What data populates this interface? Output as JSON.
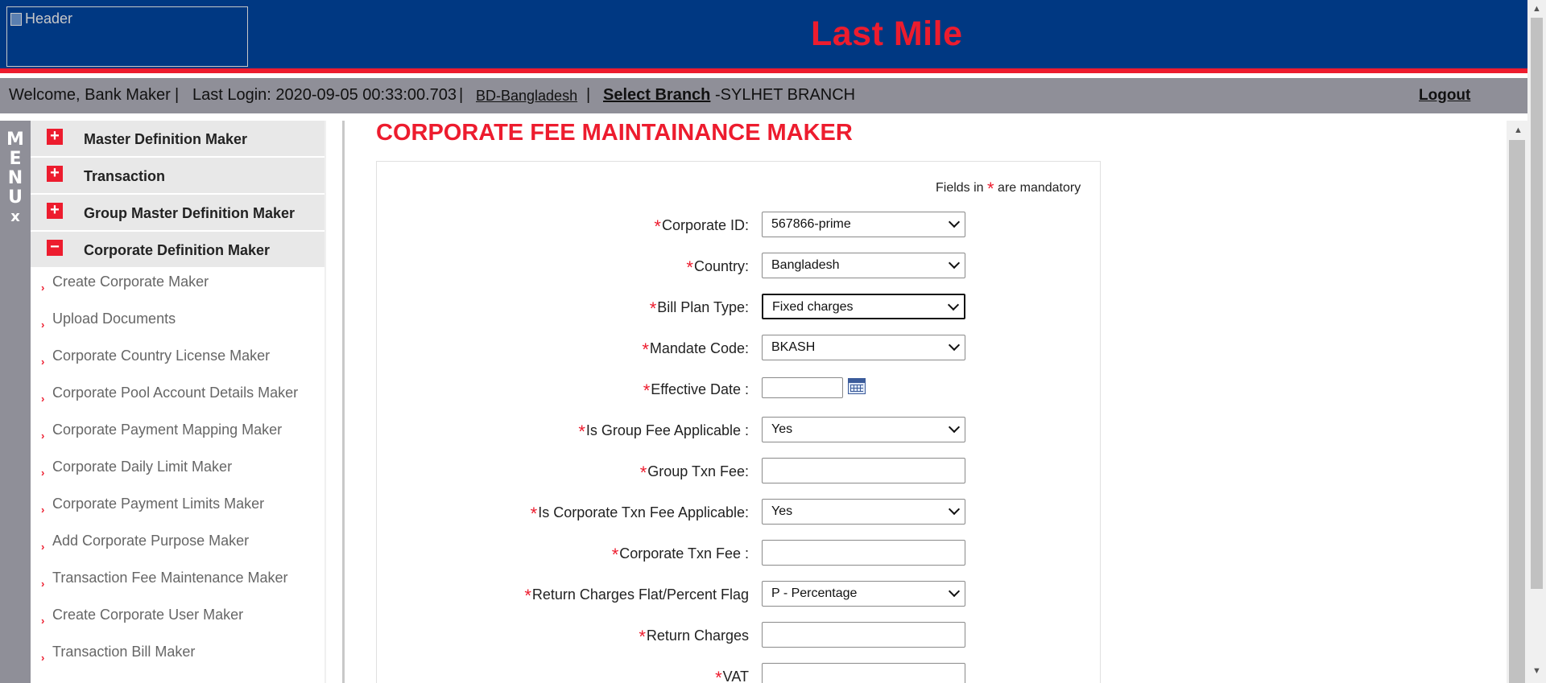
{
  "header": {
    "logo_alt": "Header",
    "title": "Last Mile"
  },
  "infobar": {
    "welcome": "Welcome, Bank Maker",
    "sep": "|",
    "last_login": "Last Login: 2020-09-05 00:33:00.703",
    "country_link": "BD-Bangladesh",
    "select_branch": "Select Branch",
    "branch_name": "-SYLHET BRANCH",
    "logout": "Logout"
  },
  "menu_strip": {
    "letters": [
      "M",
      "E",
      "N",
      "U"
    ],
    "close": "x"
  },
  "sidebar": {
    "groups": [
      {
        "label": "Master Definition Maker",
        "toggle": "+"
      },
      {
        "label": "Transaction",
        "toggle": "+"
      },
      {
        "label": "Group Master Definition Maker",
        "toggle": "+"
      },
      {
        "label": "Corporate Definition Maker",
        "toggle": "−"
      }
    ],
    "items": [
      "Create Corporate Maker",
      "Upload Documents",
      "Corporate Country License Maker",
      "Corporate Pool Account Details Maker",
      "Corporate Payment Mapping Maker",
      "Corporate Daily Limit Maker",
      "Corporate Payment Limits Maker",
      "Add Corporate Purpose Maker",
      "Transaction Fee Maintenance Maker",
      "Create Corporate User Maker",
      "Transaction Bill Maker"
    ]
  },
  "page": {
    "title": "CORPORATE FEE MAINTAINANCE MAKER",
    "mandatory_prefix": "Fields in",
    "mandatory_star": "*",
    "mandatory_suffix": "are mandatory"
  },
  "form": {
    "corporate_id": {
      "label": "Corporate ID:",
      "value": "567866-prime"
    },
    "country": {
      "label": "Country:",
      "value": "Bangladesh"
    },
    "bill_plan_type": {
      "label": "Bill Plan Type:",
      "value": "Fixed charges"
    },
    "mandate_code": {
      "label": "Mandate Code:",
      "value": "BKASH"
    },
    "effective_date": {
      "label": "Effective Date :",
      "value": ""
    },
    "is_group_fee": {
      "label": "Is Group Fee Applicable :",
      "value": "Yes"
    },
    "group_txn_fee": {
      "label": "Group Txn Fee:",
      "value": ""
    },
    "is_corp_txn_fee": {
      "label": "Is Corporate Txn Fee Applicable:",
      "value": "Yes"
    },
    "corp_txn_fee": {
      "label": "Corporate Txn Fee :",
      "value": ""
    },
    "return_flag": {
      "label": "Return Charges Flat/Percent Flag",
      "value": "P - Percentage"
    },
    "return_charges": {
      "label": "Return Charges",
      "value": ""
    },
    "vat": {
      "label": "VAT",
      "value": ""
    }
  },
  "colors": {
    "header_bg": "#003882",
    "accent_red": "#ed1c2e",
    "infobar_bg": "#8f8f98"
  }
}
